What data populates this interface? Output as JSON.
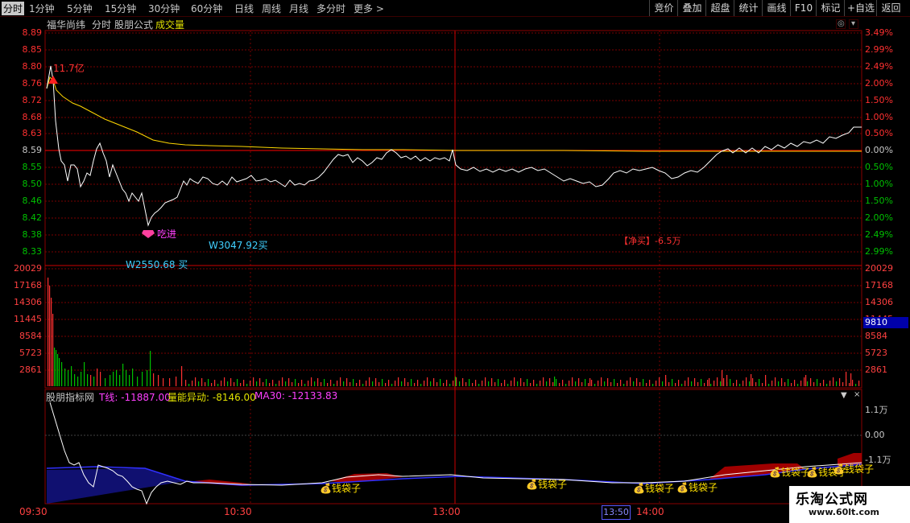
{
  "toolbar": {
    "periods": [
      "分时",
      "1分钟",
      "5分钟",
      "15分钟",
      "30分钟",
      "60分钟",
      "日线",
      "周线",
      "月线",
      "多分时",
      "更多 >"
    ],
    "right": [
      "竞价",
      "叠加",
      "超盘",
      "统计",
      "画线",
      "F10",
      "标记",
      "+自选",
      "返回"
    ]
  },
  "header": {
    "stock": "福华尚纬",
    "mode": "分时",
    "formula": "股朋公式",
    "indicator": "成交量"
  },
  "price_axis": {
    "left": [
      "8.89",
      "8.85",
      "8.80",
      "8.76",
      "8.72",
      "8.68",
      "8.63",
      "8.59",
      "8.55",
      "8.50",
      "8.46",
      "8.42",
      "8.38",
      "8.33"
    ],
    "right": [
      "3.49%",
      "2.99%",
      "2.49%",
      "2.00%",
      "1.50%",
      "1.00%",
      "0.50%",
      "0.00%",
      "0.50%",
      "1.00%",
      "1.50%",
      "2.00%",
      "2.49%",
      "2.99%"
    ]
  },
  "volume_axis": {
    "labels": [
      "20029",
      "17168",
      "14306",
      "11445",
      "8584",
      "5723",
      "2861"
    ],
    "highlight": "9810"
  },
  "annotations": {
    "amount": "11.7亿",
    "eat": "吃进",
    "w1": "W3047.92买",
    "w2": "W2550.68 买",
    "net": "【净买】-6.5万"
  },
  "indicator": {
    "name": "股朋指标网",
    "t_label": "T线: -11887.00",
    "vol_label": "量能异动: -8146.00",
    "ma_label": "MA30: -12133.83",
    "axis": [
      "1.1万",
      "0.00",
      "-1.1万"
    ],
    "bag": "钱袋子"
  },
  "time_axis": [
    "09:30",
    "10:30",
    "13:00",
    "14:00"
  ],
  "cursor_time": "13:50",
  "watermark": {
    "name": "乐淘公式网",
    "url": "www.60lt.com"
  },
  "colors": {
    "up": "#ff3030",
    "down": "#00c000",
    "avg": "#ffd700",
    "price": "#ffffff",
    "grid": "#7a0000"
  }
}
